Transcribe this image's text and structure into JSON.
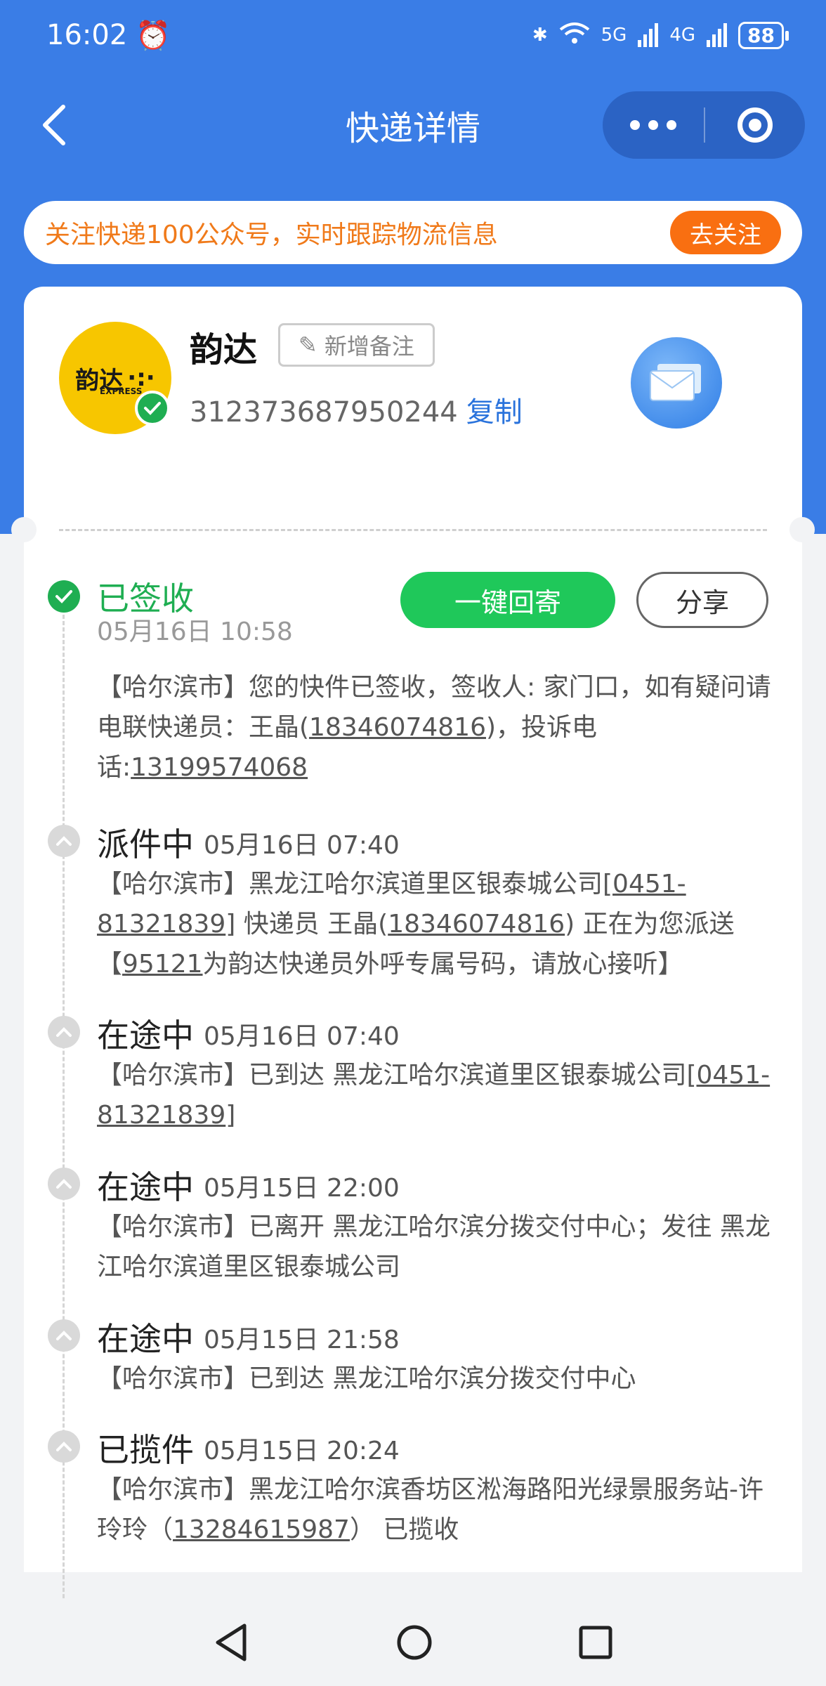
{
  "status_bar": {
    "time": "16:02",
    "network_5g": "5G",
    "network_4g": "4G",
    "battery": "88"
  },
  "nav": {
    "title": "快递详情"
  },
  "banner": {
    "text": "关注快递100公众号，实时跟踪物流信息",
    "button": "去关注"
  },
  "package": {
    "company": "韵达",
    "logo_text": "韵达",
    "logo_sub": "EXPRESS",
    "note_button": "新增备注",
    "tracking_number": "312373687950244",
    "copy_label": "复制"
  },
  "actions": {
    "return_button": "一键回寄",
    "share_button": "分享"
  },
  "timeline": [
    {
      "status": "已签收",
      "time": "05月16日 10:58",
      "desc_parts": [
        "【哈尔滨市】您的快件已签收，签收人: 家门口，如有疑问请电联快递员：王晶(",
        "18346074816",
        ")，投诉电话:",
        "13199574068",
        ""
      ]
    },
    {
      "status": "派件中",
      "time": "05月16日 07:40",
      "desc_parts": [
        "【哈尔滨市】黑龙江哈尔滨道里区银泰城公司[",
        "0451-81321839",
        "] 快递员 王晶(",
        "18346074816",
        ") 正在为您派送【",
        "95121",
        "为韵达快递员外呼专属号码，请放心接听】"
      ]
    },
    {
      "status": "在途中",
      "time": "05月16日 07:40",
      "desc_parts": [
        "【哈尔滨市】已到达 黑龙江哈尔滨道里区银泰城公司[",
        "0451-81321839",
        "]"
      ]
    },
    {
      "status": "在途中",
      "time": "05月15日 22:00",
      "desc_parts": [
        "【哈尔滨市】已离开 黑龙江哈尔滨分拨交付中心；发往 黑龙江哈尔滨道里区银泰城公司"
      ]
    },
    {
      "status": "在途中",
      "time": "05月15日 21:58",
      "desc_parts": [
        "【哈尔滨市】已到达 黑龙江哈尔滨分拨交付中心"
      ]
    },
    {
      "status": "已揽件",
      "time": "05月15日 20:24",
      "desc_parts": [
        "【哈尔滨市】黑龙江哈尔滨香坊区淞海路阳光绿景服务站-许玲玲（",
        "13284615987",
        "） 已揽收"
      ]
    }
  ],
  "colors": {
    "primary_blue": "#3a7de6",
    "green": "#1fae52",
    "orange": "#f96f11"
  }
}
